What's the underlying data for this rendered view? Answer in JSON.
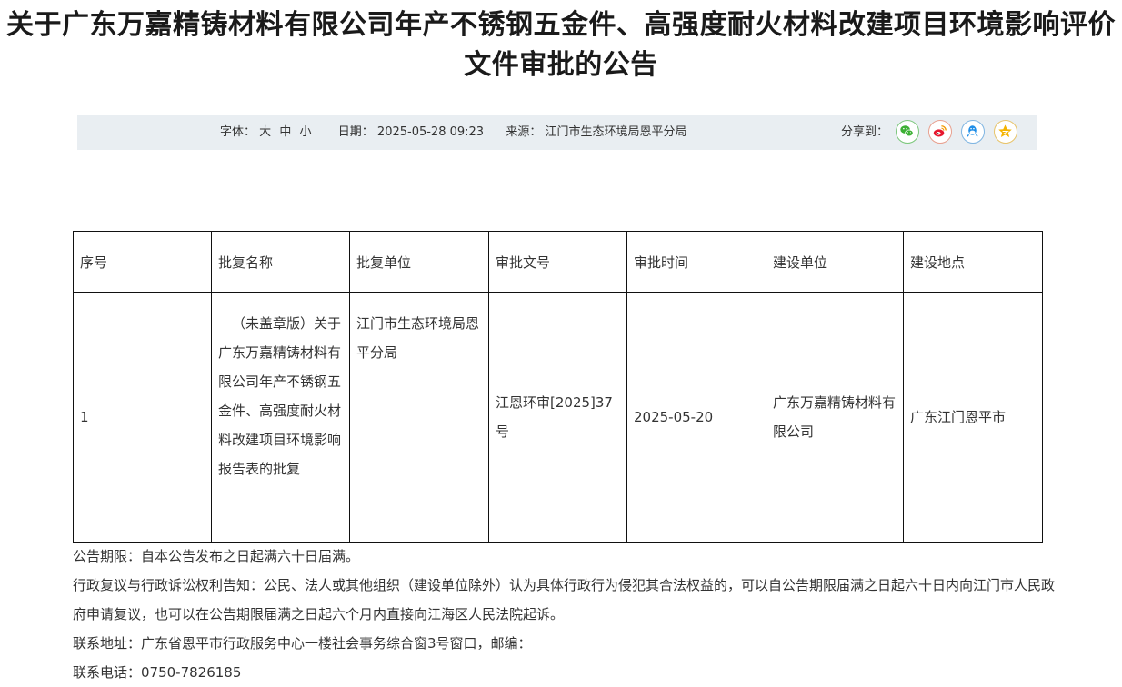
{
  "title": "关于广东万嘉精铸材料有限公司年产不锈钢五金件、高强度耐火材料改建项目环境影响评价文件审批的公告",
  "meta": {
    "font_label": "字体：",
    "font_sizes": [
      "大",
      "中",
      "小"
    ],
    "date_label": "日期：",
    "date_value": "2025-05-28 09:23",
    "source_label": "来源：",
    "source_value": "江门市生态环境局恩平分局",
    "share_label": "分享到："
  },
  "share_icons": [
    {
      "name": "wechat-icon",
      "color": "#3cb034"
    },
    {
      "name": "weibo-icon",
      "color": "#e6162d"
    },
    {
      "name": "qq-icon",
      "color": "#1e8ee8"
    },
    {
      "name": "qzone-icon",
      "color": "#f5b400"
    }
  ],
  "table": {
    "headers": [
      "序号",
      "批复名称",
      "批复单位",
      "审批文号",
      "审批时间",
      "建设单位",
      "建设地点"
    ],
    "rows": [
      {
        "index": "1",
        "name": "（未盖章版）关于广东万嘉精铸材料有限公司年产不锈钢五金件、高强度耐火材料改建项目环境影响报告表的批复",
        "unit": "江门市生态环境局恩平分局",
        "doc_no": "江恩环审[2025]37号",
        "date": "2025-05-20",
        "builder": "广东万嘉精铸材料有限公司",
        "location": "广东江门恩平市"
      }
    ]
  },
  "footer": {
    "period": "公告期限：自本公告发布之日起满六十日届满。",
    "rights": "行政复议与行政诉讼权利告知：公民、法人或其他组织（建设单位除外）认为具体行政行为侵犯其合法权益的，可以自公告期限届满之日起六十日内向江门市人民政府申请复议，也可以在公告期限届满之日起六个月内直接向江海区人民法院起诉。",
    "address": "联系地址：广东省恩平市行政服务中心一楼社会事务综合窗3号窗口，邮编：",
    "phone": "联系电话：0750-7826185"
  }
}
